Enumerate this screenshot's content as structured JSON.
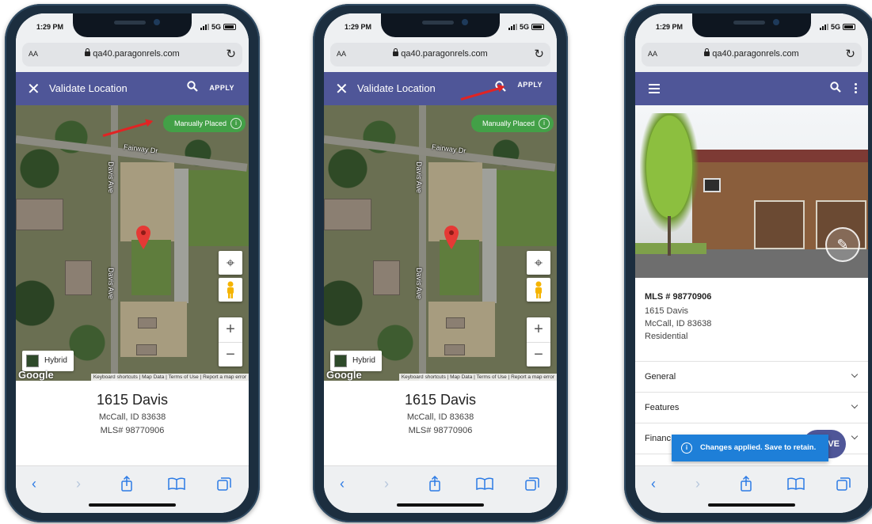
{
  "phones": [
    {
      "status": {
        "time": "1:29 PM",
        "network": "5G"
      },
      "browser": {
        "text_size_label": "AA",
        "url": "qa40.paragonrels.com"
      },
      "appbar": {
        "title": "Validate Location",
        "apply_label": "APPLY"
      },
      "map": {
        "location_badge": "Manually Placed",
        "street_labels": {
          "fairway": "Fairway Dr",
          "davis_upper": "Davis Ave",
          "davis_lower": "Davis Ave"
        },
        "map_type_label": "Hybrid",
        "google_logo": "Google",
        "footer_links": "Keyboard shortcuts | Map Data | Terms of Use | Report a map error"
      },
      "address": {
        "street": "1615 Davis",
        "city": "McCall, ID 83638",
        "mls": "MLS# 98770906"
      }
    },
    {
      "status": {
        "time": "1:29 PM",
        "network": "5G"
      },
      "browser": {
        "text_size_label": "AA",
        "url": "qa40.paragonrels.com"
      },
      "appbar": {
        "title": "Validate Location",
        "apply_label": "APPLY"
      },
      "map": {
        "location_badge": "Manually Placed",
        "street_labels": {
          "fairway": "Fairway Dr",
          "davis_upper": "Davis Ave",
          "davis_lower": "Davis Ave"
        },
        "map_type_label": "Hybrid",
        "google_logo": "Google",
        "footer_links": "Keyboard shortcuts | Map Data | Terms of Use | Report a map error"
      },
      "address": {
        "street": "1615 Davis",
        "city": "McCall, ID 83638",
        "mls": "MLS# 98770906"
      }
    },
    {
      "status": {
        "time": "1:29 PM",
        "network": "5G"
      },
      "browser": {
        "text_size_label": "AA",
        "url": "qa40.paragonrels.com"
      },
      "listing": {
        "mls_number": "MLS # 98770906",
        "street": "1615 Davis",
        "city": "McCall, ID 83638",
        "type": "Residential"
      },
      "sections": [
        "General",
        "Features",
        "Financ"
      ],
      "fab_label": "VE",
      "toast": "Changes applied. Save to retain."
    }
  ],
  "colors": {
    "appbar": "#4f5698",
    "badge_green": "#43a047",
    "toast_blue": "#1e7fd8",
    "arrow_red": "#e02424",
    "safari_blue": "#2c7be5"
  },
  "icons": [
    "close-icon",
    "search-icon",
    "lock-icon",
    "reload-icon",
    "info-icon",
    "map-pin-icon",
    "locate-icon",
    "pegman-icon",
    "zoom-in-icon",
    "zoom-out-icon",
    "back-icon",
    "forward-icon",
    "share-icon",
    "bookmarks-icon",
    "tabs-icon",
    "menu-icon",
    "more-icon",
    "edit-photo-icon",
    "chevron-down-icon"
  ]
}
